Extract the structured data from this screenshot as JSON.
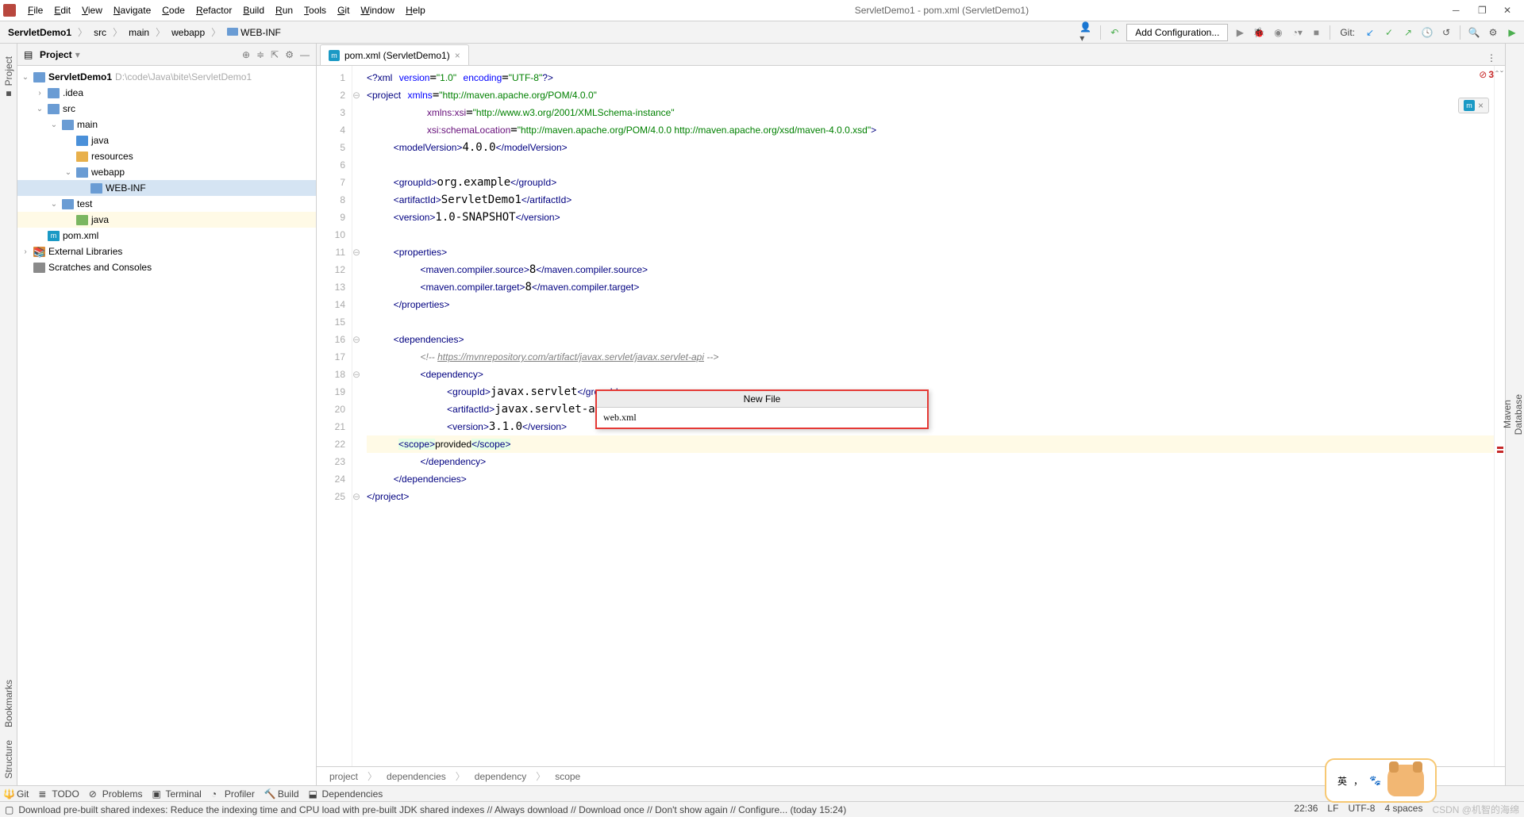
{
  "title_center": "ServletDemo1 - pom.xml (ServletDemo1)",
  "menu": [
    "File",
    "Edit",
    "View",
    "Navigate",
    "Code",
    "Refactor",
    "Build",
    "Run",
    "Tools",
    "Git",
    "Window",
    "Help"
  ],
  "breadcrumb": [
    "ServletDemo1",
    "src",
    "main",
    "webapp",
    "WEB-INF"
  ],
  "toolbar": {
    "add_config": "Add Configuration...",
    "git": "Git:"
  },
  "project": {
    "title": "Project",
    "root": {
      "name": "ServletDemo1",
      "path": "D:\\code\\Java\\bite\\ServletDemo1"
    },
    "idea": ".idea",
    "src": "src",
    "main": "main",
    "java": "java",
    "resources": "resources",
    "webapp": "webapp",
    "webinf": "WEB-INF",
    "test": "test",
    "testjava": "java",
    "pom": "pom.xml",
    "extlib": "External Libraries",
    "scratch": "Scratches and Consoles"
  },
  "tab": {
    "name": "pom.xml (ServletDemo1)"
  },
  "errors": {
    "count": "3"
  },
  "popup": {
    "title": "New File",
    "value": "web.xml"
  },
  "code_breadcrumb": [
    "project",
    "dependencies",
    "dependency",
    "scope"
  ],
  "status_tabs": [
    "Git",
    "TODO",
    "Problems",
    "Terminal",
    "Profiler",
    "Build",
    "Dependencies"
  ],
  "status_msg": "Download pre-built shared indexes: Reduce the indexing time and CPU load with pre-built JDK shared indexes // Always download // Download once // Don't show again // Configure... (today 15:24)",
  "status_right": {
    "pos": "22:36",
    "lf": "LF",
    "enc": "UTF-8",
    "indent": "4 spaces"
  },
  "ime": {
    "lang": "英",
    "comma": "，"
  },
  "watermark": "CSDN @机智的海绵",
  "right_rail": [
    "Database",
    "Maven"
  ],
  "line_numbers": [
    "1",
    "2",
    "3",
    "4",
    "5",
    "6",
    "7",
    "8",
    "9",
    "10",
    "11",
    "12",
    "13",
    "14",
    "15",
    "16",
    "17",
    "18",
    "19",
    "20",
    "21",
    "22",
    "23",
    "24",
    "25"
  ]
}
